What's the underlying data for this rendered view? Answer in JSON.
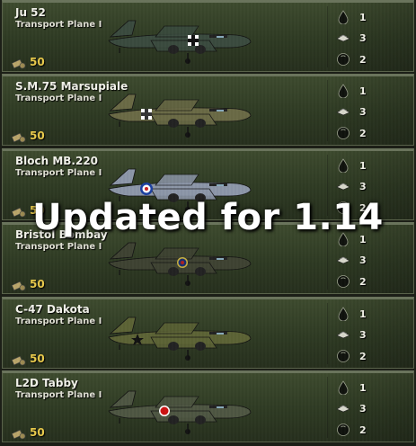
{
  "cards": [
    {
      "name": "Ju 52",
      "type": "Transport Plane I",
      "cost": "50",
      "stats": [
        "1",
        "3",
        "2"
      ],
      "camo": "#3a4a3e",
      "roundel": "cross-icon"
    },
    {
      "name": "S.M.75 Marsupiale",
      "type": "Transport Plane I",
      "cost": "50",
      "stats": [
        "1",
        "3",
        "2"
      ],
      "camo": "#6a6a45",
      "roundel": "fasces-cross-icon"
    },
    {
      "name": "Bloch MB.220",
      "type": "Transport Plane I",
      "cost": "50",
      "stats": [
        "1",
        "3",
        "2"
      ],
      "camo": "#8c96a8",
      "roundel": "french-roundel-icon"
    },
    {
      "name": "Bristol Bombay",
      "type": "Transport Plane I",
      "cost": "50",
      "stats": [
        "1",
        "3",
        "2"
      ],
      "camo": "#3e4232",
      "roundel": "raf-roundel-icon"
    },
    {
      "name": "C-47 Dakota",
      "type": "Transport Plane I",
      "cost": "50",
      "stats": [
        "1",
        "3",
        "2"
      ],
      "camo": "#5c6335",
      "roundel": "usaaf-star-icon"
    },
    {
      "name": "L2D Tabby",
      "type": "Transport Plane I",
      "cost": "50",
      "stats": [
        "1",
        "3",
        "2"
      ],
      "camo": "#4e5642",
      "roundel": "hinomaru-icon"
    }
  ],
  "overlay_text": "Updated for 1.14",
  "colors": {
    "cost": "#e8c94a",
    "panel": "#2e3a23",
    "border": "#59624a"
  }
}
